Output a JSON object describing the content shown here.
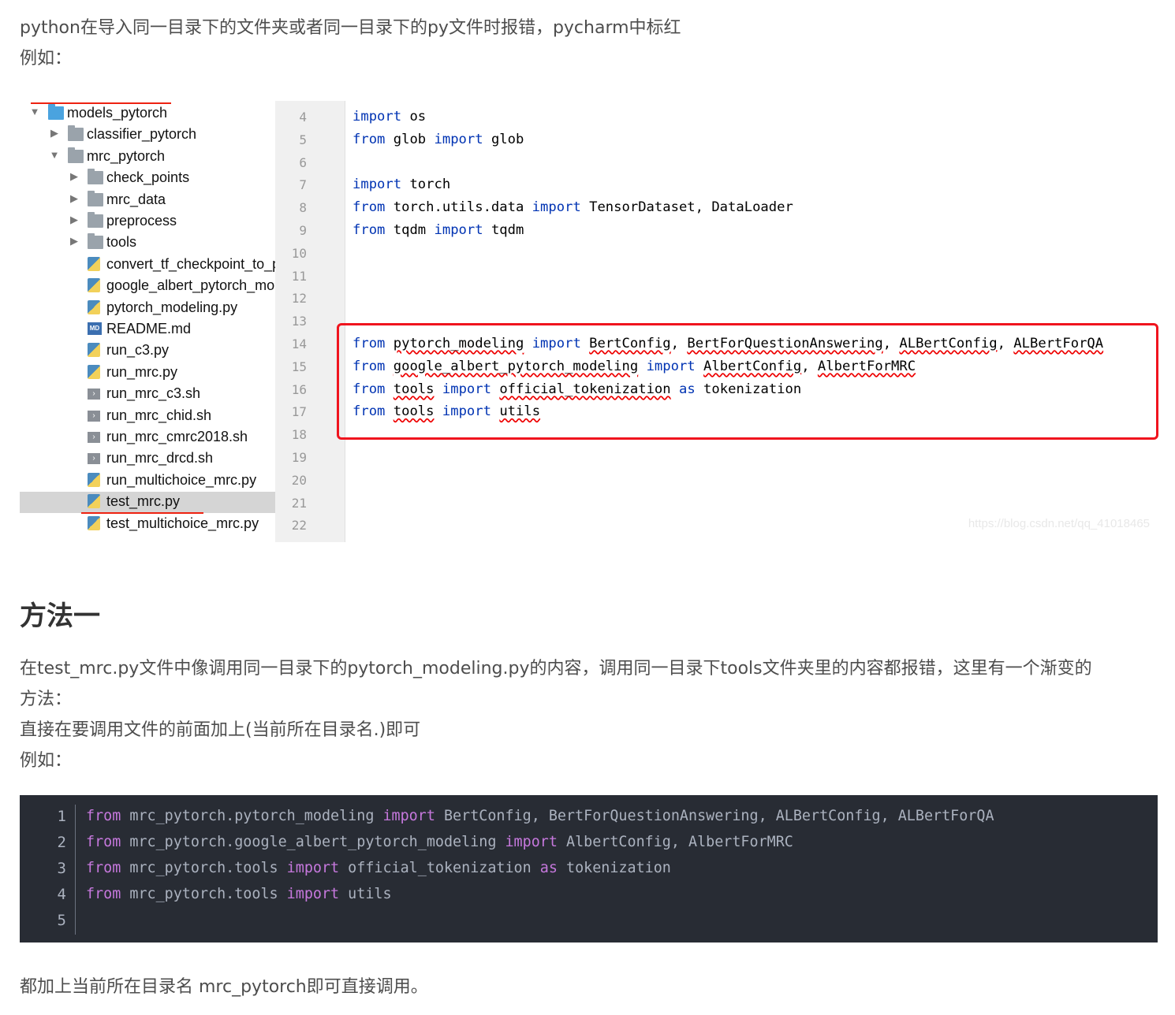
{
  "intro": {
    "line1": "python在导入同一目录下的文件夹或者同一目录下的py文件时报错，pycharm中标红",
    "line2": "例如："
  },
  "ide": {
    "tree": [
      {
        "label": "models_pytorch",
        "type": "folder-root",
        "indent": 0,
        "expanded": true
      },
      {
        "label": "classifier_pytorch",
        "type": "folder",
        "indent": 1,
        "expanded": false
      },
      {
        "label": "mrc_pytorch",
        "type": "folder",
        "indent": 1,
        "expanded": true
      },
      {
        "label": "check_points",
        "type": "folder",
        "indent": 2,
        "expanded": false
      },
      {
        "label": "mrc_data",
        "type": "folder",
        "indent": 2,
        "expanded": false
      },
      {
        "label": "preprocess",
        "type": "folder",
        "indent": 2,
        "expanded": false
      },
      {
        "label": "tools",
        "type": "folder",
        "indent": 2,
        "expanded": false
      },
      {
        "label": "convert_tf_checkpoint_to_p",
        "type": "py",
        "indent": 2
      },
      {
        "label": "google_albert_pytorch_mo",
        "type": "py",
        "indent": 2
      },
      {
        "label": "pytorch_modeling.py",
        "type": "py",
        "indent": 2
      },
      {
        "label": "README.md",
        "type": "md",
        "indent": 2
      },
      {
        "label": "run_c3.py",
        "type": "py",
        "indent": 2
      },
      {
        "label": "run_mrc.py",
        "type": "py",
        "indent": 2
      },
      {
        "label": "run_mrc_c3.sh",
        "type": "sh",
        "indent": 2
      },
      {
        "label": "run_mrc_chid.sh",
        "type": "sh",
        "indent": 2
      },
      {
        "label": "run_mrc_cmrc2018.sh",
        "type": "sh",
        "indent": 2
      },
      {
        "label": "run_mrc_drcd.sh",
        "type": "sh",
        "indent": 2
      },
      {
        "label": "run_multichoice_mrc.py",
        "type": "py",
        "indent": 2
      },
      {
        "label": "test_mrc.py",
        "type": "py",
        "indent": 2,
        "selected": true
      },
      {
        "label": "test_multichoice_mrc.py",
        "type": "py",
        "indent": 2
      }
    ],
    "line_numbers": [
      "4",
      "5",
      "6",
      "7",
      "8",
      "9",
      "10",
      "11",
      "12",
      "13",
      "14",
      "15",
      "16",
      "17",
      "18",
      "19",
      "20",
      "21",
      "22"
    ],
    "code": [
      [
        {
          "t": "import",
          "k": "kw"
        },
        {
          "t": " os"
        }
      ],
      [
        {
          "t": "from",
          "k": "kw"
        },
        {
          "t": " glob "
        },
        {
          "t": "import",
          "k": "kw"
        },
        {
          "t": " glob"
        }
      ],
      [],
      [
        {
          "t": "import",
          "k": "kw"
        },
        {
          "t": " torch"
        }
      ],
      [
        {
          "t": "from",
          "k": "kw"
        },
        {
          "t": " torch.utils.data "
        },
        {
          "t": "import",
          "k": "kw"
        },
        {
          "t": " TensorDataset, DataLoader"
        }
      ],
      [
        {
          "t": "from",
          "k": "kw"
        },
        {
          "t": " tqdm "
        },
        {
          "t": "import",
          "k": "kw"
        },
        {
          "t": " tqdm"
        }
      ],
      [],
      [],
      [],
      [],
      [
        {
          "t": "from",
          "k": "kw"
        },
        {
          "t": " "
        },
        {
          "t": "pytorch_modeling",
          "k": "err"
        },
        {
          "t": " "
        },
        {
          "t": "import",
          "k": "kw"
        },
        {
          "t": " "
        },
        {
          "t": "BertConfig",
          "k": "err"
        },
        {
          "t": ", "
        },
        {
          "t": "BertForQuestionAnswering",
          "k": "err"
        },
        {
          "t": ", "
        },
        {
          "t": "ALBertConfig",
          "k": "err"
        },
        {
          "t": ", "
        },
        {
          "t": "ALBertForQA",
          "k": "err"
        }
      ],
      [
        {
          "t": "from",
          "k": "kw"
        },
        {
          "t": " "
        },
        {
          "t": "google_albert_pytorch_modeling",
          "k": "err"
        },
        {
          "t": " "
        },
        {
          "t": "import",
          "k": "kw"
        },
        {
          "t": " "
        },
        {
          "t": "AlbertConfig",
          "k": "err"
        },
        {
          "t": ", "
        },
        {
          "t": "AlbertForMRC",
          "k": "err"
        }
      ],
      [
        {
          "t": "from",
          "k": "kw"
        },
        {
          "t": " "
        },
        {
          "t": "tools",
          "k": "err"
        },
        {
          "t": " "
        },
        {
          "t": "import",
          "k": "kw"
        },
        {
          "t": " "
        },
        {
          "t": "official_tokenization",
          "k": "err"
        },
        {
          "t": " "
        },
        {
          "t": "as",
          "k": "kw"
        },
        {
          "t": " tokenization"
        }
      ],
      [
        {
          "t": "from",
          "k": "kw"
        },
        {
          "t": " "
        },
        {
          "t": "tools",
          "k": "err"
        },
        {
          "t": " "
        },
        {
          "t": "import",
          "k": "kw"
        },
        {
          "t": " "
        },
        {
          "t": "utils",
          "k": "err"
        }
      ],
      [],
      [],
      [],
      [],
      []
    ],
    "watermark": "https://blog.csdn.net/qq_41018465"
  },
  "method": {
    "heading": "方法一",
    "p1_line1": "在test_mrc.py文件中像调用同一目录下的pytorch_modeling.py的内容，调用同一目录下tools文件夹里的内容都报错，这里有一个渐变的",
    "p1_line2": "方法：",
    "p2": "直接在要调用文件的前面加上(当前所在目录名.)即可",
    "p3": "例如："
  },
  "codeblock": {
    "line_numbers": [
      "1",
      "2",
      "3",
      "4",
      "5"
    ],
    "lines": [
      [
        {
          "t": "from",
          "k": "ck"
        },
        {
          "t": " mrc_pytorch.pytorch_modeling "
        },
        {
          "t": "import",
          "k": "ck"
        },
        {
          "t": " BertConfig, BertForQuestionAnswering, ALBertConfig, ALBertForQA"
        }
      ],
      [
        {
          "t": "from",
          "k": "ck"
        },
        {
          "t": " mrc_pytorch.google_albert_pytorch_modeling "
        },
        {
          "t": "import",
          "k": "ck"
        },
        {
          "t": " AlbertConfig, AlbertForMRC"
        }
      ],
      [
        {
          "t": "from",
          "k": "ck"
        },
        {
          "t": " mrc_pytorch.tools "
        },
        {
          "t": "import",
          "k": "ck"
        },
        {
          "t": " official_tokenization "
        },
        {
          "t": "as",
          "k": "ck"
        },
        {
          "t": " tokenization"
        }
      ],
      [
        {
          "t": "from",
          "k": "ck"
        },
        {
          "t": " mrc_pytorch.tools "
        },
        {
          "t": "import",
          "k": "ck"
        },
        {
          "t": " utils"
        }
      ],
      []
    ]
  },
  "conclusion": "都加上当前所在目录名 mrc_pytorch即可直接调用。"
}
